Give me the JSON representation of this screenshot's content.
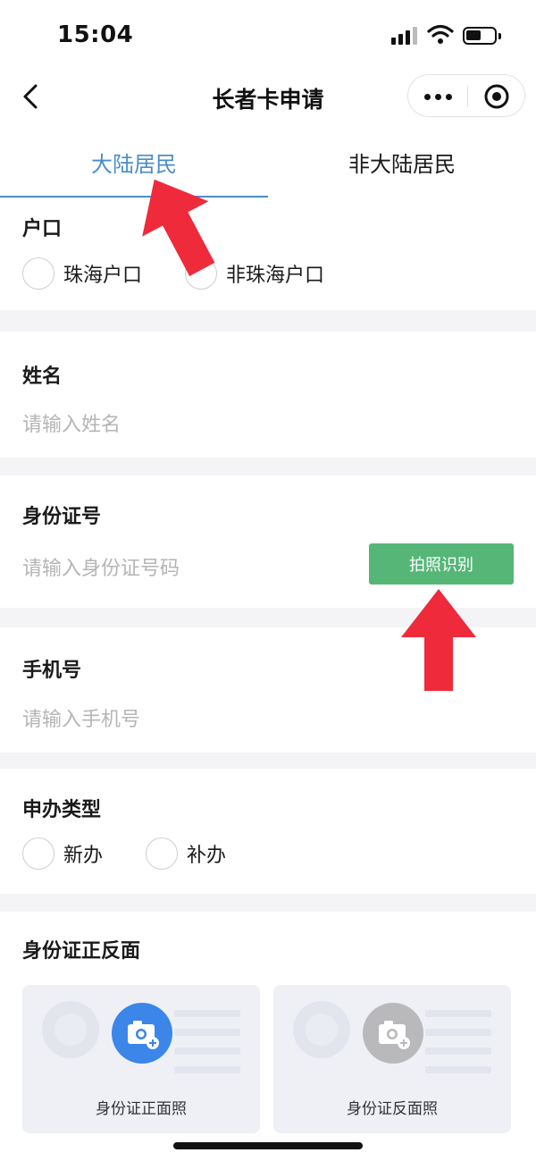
{
  "status": {
    "time": "15:04"
  },
  "navbar": {
    "title": "长者卡申请"
  },
  "tabs": [
    {
      "label": "大陆居民",
      "active": true
    },
    {
      "label": "非大陆居民",
      "active": false
    }
  ],
  "household": {
    "label": "户口",
    "options": [
      "珠海户口",
      "非珠海户口"
    ]
  },
  "name": {
    "label": "姓名",
    "placeholder": "请输入姓名"
  },
  "id_number": {
    "label": "身份证号",
    "placeholder": "请输入身份证号码",
    "button": "拍照识别"
  },
  "phone": {
    "label": "手机号",
    "placeholder": "请输入手机号"
  },
  "apply_type": {
    "label": "申办类型",
    "options": [
      "新办",
      "补办"
    ]
  },
  "id_photos": {
    "label": "身份证正反面",
    "front_caption": "身份证正面照",
    "back_caption": "身份证反面照"
  },
  "colors": {
    "accent": "#4a8ec7",
    "button_green": "#55b678",
    "arrow_red": "#ef2a3b",
    "camera_blue": "#3b86e8"
  },
  "icons": [
    "back-chevron-icon",
    "more-icon",
    "target-icon",
    "camera-icon",
    "arrow-icon"
  ]
}
